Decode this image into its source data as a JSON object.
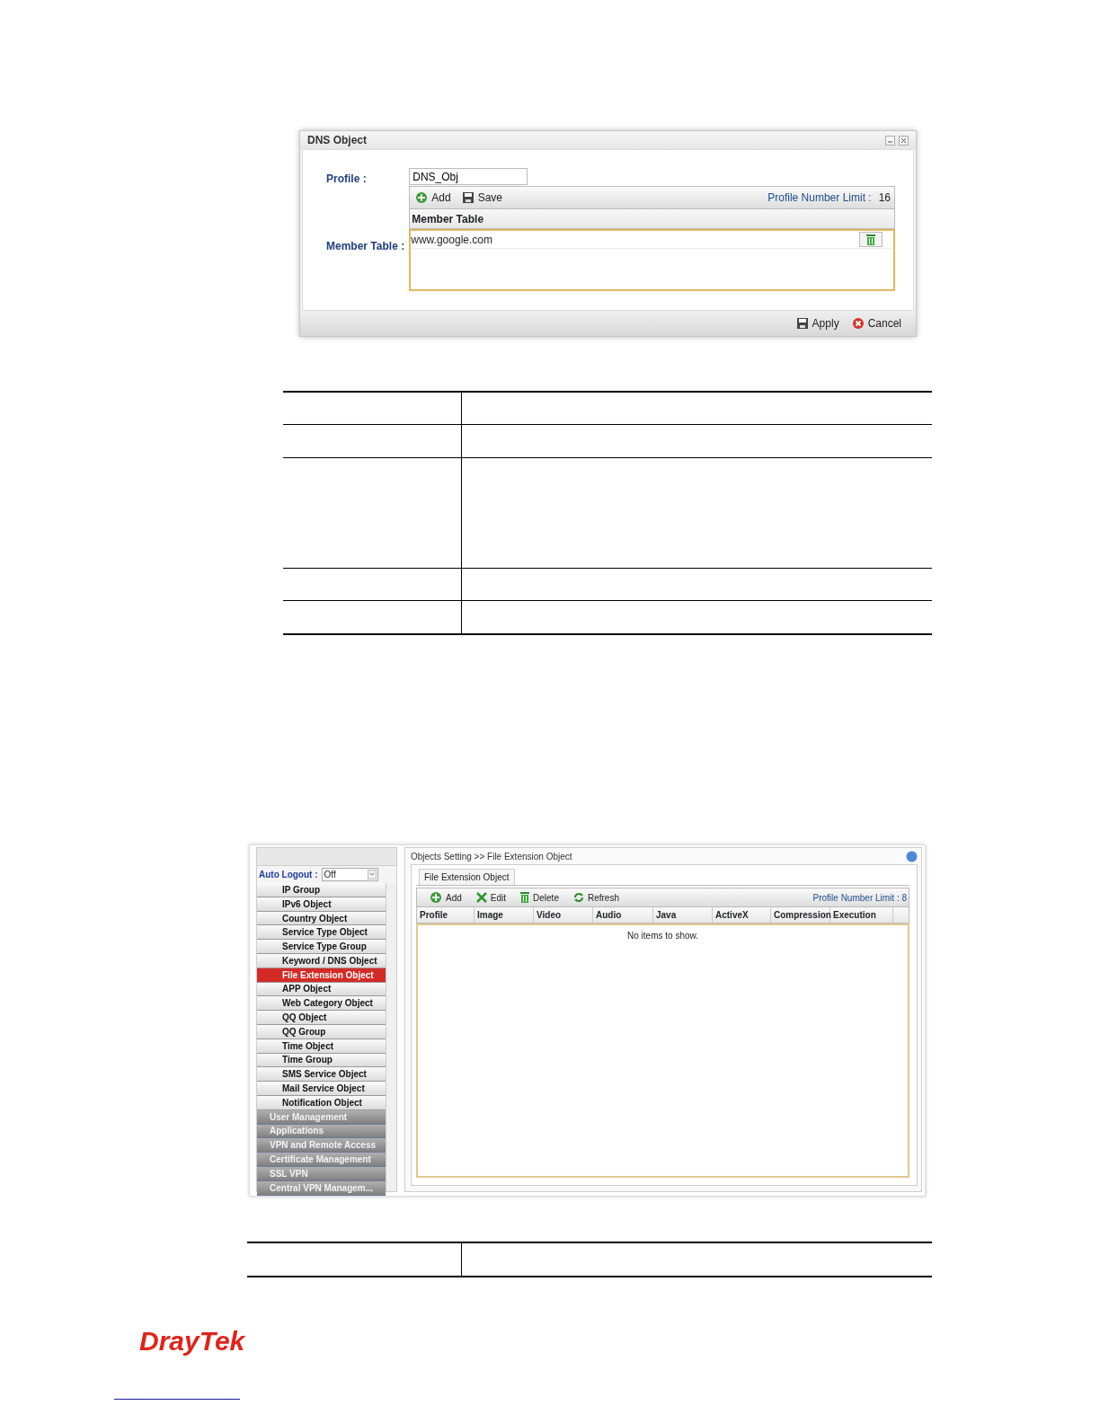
{
  "dns_dialog": {
    "title": "DNS Object",
    "profile_label": "Profile :",
    "profile_value": "DNS_Obj",
    "toolbar": [
      {
        "kind": "add",
        "label": "Add"
      },
      {
        "kind": "save",
        "label": "Save"
      }
    ],
    "limit_label": "Profile Number Limit :",
    "limit_value": "16",
    "member_label": "Member Table :",
    "table_header": "Member Table",
    "members": [
      "www.google.com"
    ],
    "footer": [
      {
        "kind": "save",
        "label": "Apply"
      },
      {
        "kind": "cancel",
        "label": "Cancel"
      }
    ]
  },
  "router_screen": {
    "auto_logout_label": "Auto Logout :",
    "auto_logout_value": "Off",
    "menu": [
      {
        "label": "IP Group",
        "selected": false
      },
      {
        "label": "IPv6 Object",
        "selected": false
      },
      {
        "label": "Country Object",
        "selected": false
      },
      {
        "label": "Service Type Object",
        "selected": false
      },
      {
        "label": "Service Type Group",
        "selected": false
      },
      {
        "label": "Keyword / DNS Object",
        "selected": false
      },
      {
        "label": "File Extension Object",
        "selected": true
      },
      {
        "label": "APP Object",
        "selected": false
      },
      {
        "label": "Web Category Object",
        "selected": false
      },
      {
        "label": "QQ Object",
        "selected": false
      },
      {
        "label": "QQ Group",
        "selected": false
      },
      {
        "label": "Time Object",
        "selected": false
      },
      {
        "label": "Time Group",
        "selected": false
      },
      {
        "label": "SMS Service Object",
        "selected": false
      },
      {
        "label": "Mail Service Object",
        "selected": false
      },
      {
        "label": "Notification Object",
        "selected": false
      }
    ],
    "sections": [
      "User Management",
      "Applications",
      "VPN and Remote Access",
      "Certificate Management",
      "SSL VPN",
      "Central VPN Managem..."
    ],
    "breadcrumb": "Objects Setting >> File Extension Object",
    "tab": "File Extension Object",
    "toolbar": [
      {
        "kind": "add",
        "label": "Add"
      },
      {
        "kind": "edit",
        "label": "Edit"
      },
      {
        "kind": "delete",
        "label": "Delete"
      },
      {
        "kind": "refresh",
        "label": "Refresh"
      }
    ],
    "limit": "Profile Number Limit :  8",
    "columns": [
      "Profile",
      "Image",
      "Video",
      "Audio",
      "Java",
      "ActiveX",
      "Compression",
      "Execution"
    ],
    "empty_message": "No items to show."
  },
  "logo": "DrayTek"
}
